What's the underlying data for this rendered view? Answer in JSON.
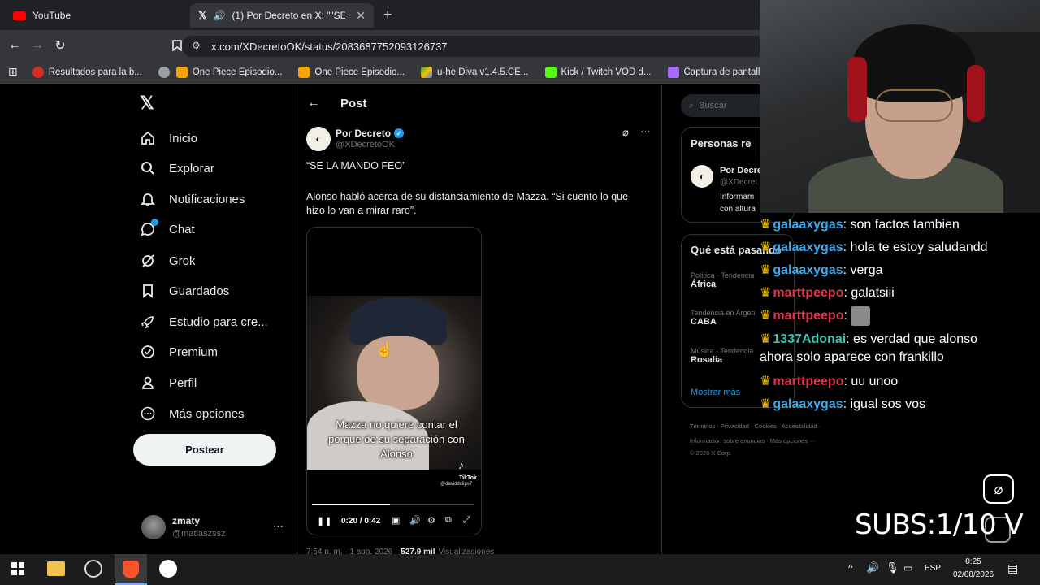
{
  "browser": {
    "tabs": [
      {
        "label": "YouTube"
      },
      {
        "label": "(1) Por Decreto en X: \"\"SE LA"
      }
    ],
    "url": "x.com/XDecretoOK/status/2083687752093126737",
    "bookmarks": [
      "Resultados para la b...",
      "One Piece Episodio...",
      "One Piece Episodio...",
      "u-he Diva v1.4.5.CE...",
      "Kick / Twitch VOD d...",
      "Captura de pantalla..."
    ]
  },
  "nav": {
    "items": [
      "Inicio",
      "Explorar",
      "Notificaciones",
      "Chat",
      "Grok",
      "Guardados",
      "Estudio para cre...",
      "Premium",
      "Perfil",
      "Más opciones"
    ],
    "post_button": "Postear",
    "account_name": "zmaty",
    "account_handle": "@matiaszssz"
  },
  "post": {
    "header": "Post",
    "author_name": "Por Decreto",
    "author_handle": "@XDecretoOK",
    "quote": "“SE LA MANDO FEO”",
    "body": "Alonso habló acerca de su distanciamiento de Mazza. “Si cuento lo que hizo lo van a mirar raro”.",
    "video_caption": "Mazza no quiere contar el porque de su separación con Alonso",
    "video_time": "0:20 / 0:42",
    "tiktok_label": "TikTok",
    "tiktok_user": "@daviddclips7",
    "progress": 0.48,
    "footer_time": "7:54 p. m. · 1 ago. 2026 ·",
    "footer_views": "527,9 mil",
    "footer_views_label": "Visualizaciones"
  },
  "right": {
    "search_placeholder": "Buscar",
    "people_title": "Personas re",
    "people_name": "Por Decre",
    "people_handle": "@XDecret",
    "people_bio_1": "Informam",
    "people_bio_2": "con altura",
    "trends_title": "Qué está pasando",
    "trends": [
      {
        "context": "Política · Tendencia",
        "name": "África"
      },
      {
        "context": "Tendencia en Argen",
        "name": "CABA"
      },
      {
        "context": "Música · Tendencia",
        "name": "Rosalía"
      }
    ],
    "show_more": "Mostrar más",
    "footer_1": "Términos · Privacidad · Cookies · Accesibilidad ·",
    "footer_2": "Información sobre anuncios · Más opciones ···",
    "footer_3": "© 2026 X Corp."
  },
  "chat": [
    {
      "user": "galaaxygas",
      "sep": ": ",
      "msg": "son factos tambien",
      "color": "#3da9e8"
    },
    {
      "user": "galaaxygas",
      "sep": ": ",
      "msg": "hola te estoy saludandd",
      "color": "#3da9e8"
    },
    {
      "user": "galaaxygas",
      "sep": ": ",
      "msg": "verga",
      "color": "#3da9e8"
    },
    {
      "user": "marttpeepo",
      "sep": ": ",
      "msg": "galatsiii",
      "color": "#e0364c"
    },
    {
      "user": "marttpeepo",
      "sep": ": ",
      "msg": "",
      "color": "#e0364c"
    },
    {
      "user": "1337Adonai",
      "sep": ": ",
      "msg": "es verdad que alonso",
      "color": "#35c6b0"
    },
    {
      "user": "",
      "sep": "",
      "msg": "ahora solo aparece con frankillo",
      "color": "#ffffff"
    },
    {
      "user": "marttpeepo",
      "sep": ": ",
      "msg": "uu unoo",
      "color": "#e0364c"
    },
    {
      "user": "galaaxygas",
      "sep": ": ",
      "msg": "igual sos vos",
      "color": "#3da9e8"
    }
  ],
  "overlay": {
    "subs": "SUBS:1/10  V"
  },
  "taskbar": {
    "lang": "ESP",
    "time": "0:25",
    "date": "02/08/2026"
  },
  "colors": {
    "x_blue": "#1d9bf0",
    "chat_blue": "#3da9e8",
    "chat_red": "#e0364c",
    "chat_teal": "#35c6b0"
  }
}
